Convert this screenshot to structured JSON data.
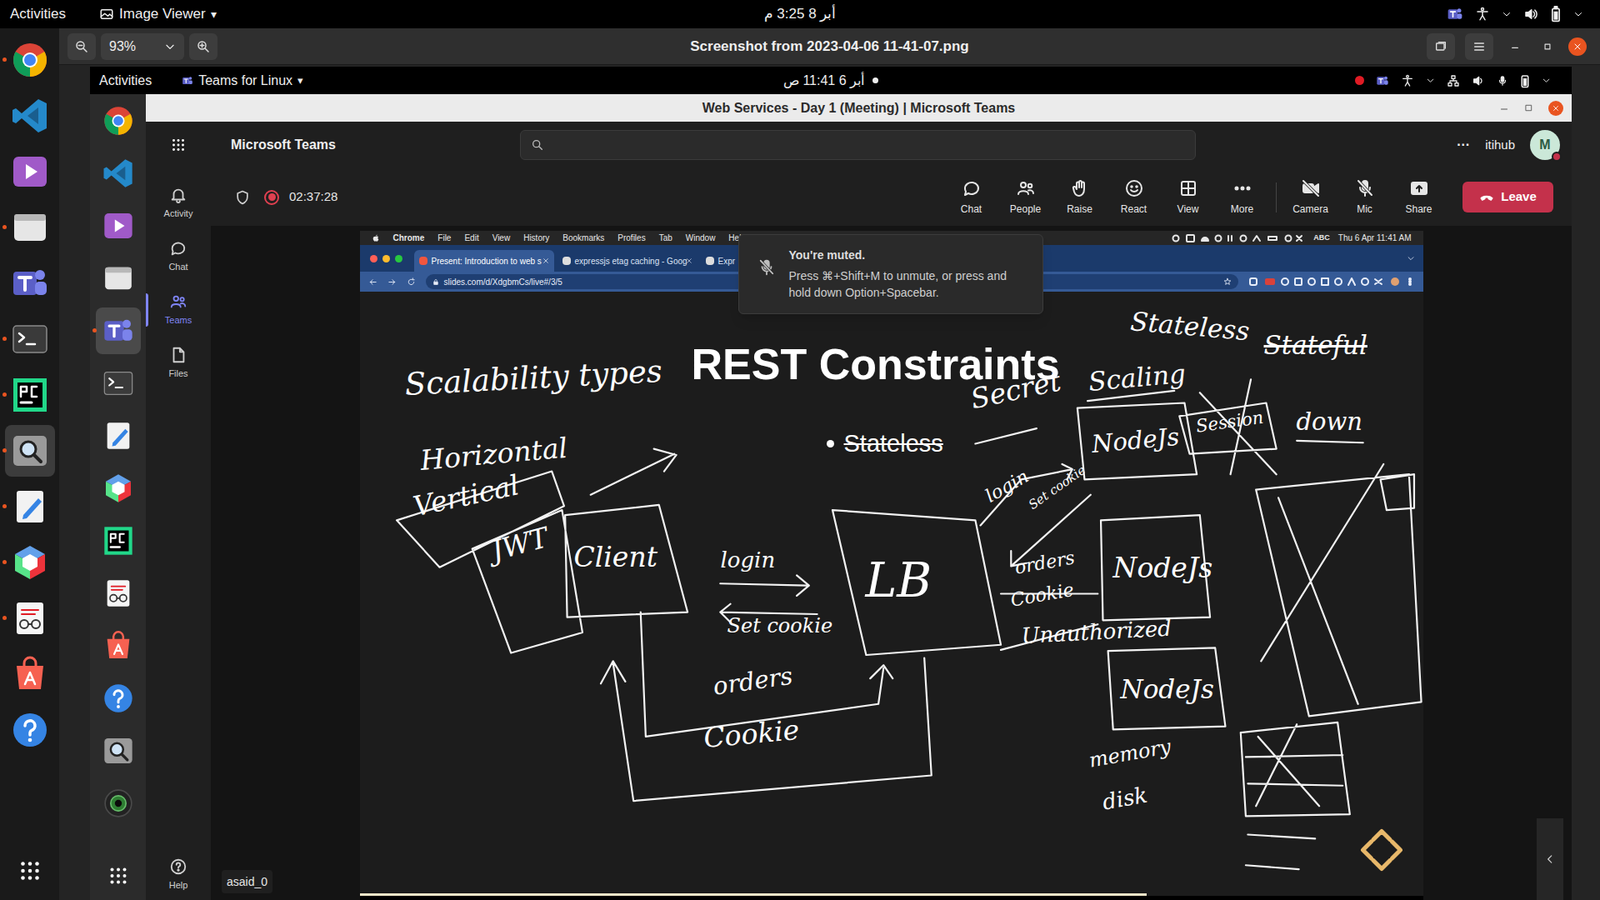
{
  "desktop": {
    "top_bar": {
      "activities": "Activities",
      "app": "Image Viewer",
      "app_menu_arrow": "▾",
      "clock": "أبر 8  3:25 م"
    },
    "dock": [
      {
        "kind": "chrome",
        "running": true,
        "selected": false
      },
      {
        "kind": "vscode",
        "running": false,
        "selected": false
      },
      {
        "kind": "videos",
        "running": false,
        "selected": false
      },
      {
        "kind": "files",
        "running": true,
        "selected": false
      },
      {
        "kind": "teams",
        "running": false,
        "selected": false
      },
      {
        "kind": "terminal",
        "running": true,
        "selected": false
      },
      {
        "kind": "pycharm",
        "running": true,
        "selected": false
      },
      {
        "kind": "magnifier",
        "running": true,
        "selected": true
      },
      {
        "kind": "editor",
        "running": true,
        "selected": false
      },
      {
        "kind": "cube",
        "running": true,
        "selected": false
      },
      {
        "kind": "docview",
        "running": true,
        "selected": false
      },
      {
        "kind": "software",
        "running": false,
        "selected": false
      },
      {
        "kind": "help",
        "running": false,
        "selected": false
      }
    ]
  },
  "viewer": {
    "zoom": "93%",
    "title": "Screenshot from 2023-04-06 11-41-07.png"
  },
  "inner_desktop": {
    "top_bar": {
      "activities": "Activities",
      "app": "Teams for Linux",
      "app_menu_arrow": "▾",
      "clock": "أبر 6  11:41 ص",
      "notification_dot": true,
      "recording_dot": true
    },
    "dock": [
      {
        "kind": "chrome",
        "running": false,
        "selected": false
      },
      {
        "kind": "vscode",
        "running": false,
        "selected": false
      },
      {
        "kind": "videos",
        "running": false,
        "selected": false
      },
      {
        "kind": "files",
        "running": false,
        "selected": false
      },
      {
        "kind": "teams",
        "running": true,
        "selected": true
      },
      {
        "kind": "terminal",
        "running": false,
        "selected": false
      },
      {
        "kind": "editor",
        "running": false,
        "selected": false
      },
      {
        "kind": "cube",
        "running": false,
        "selected": false
      },
      {
        "kind": "pycharm",
        "running": false,
        "selected": false
      },
      {
        "kind": "docview",
        "running": false,
        "selected": false
      },
      {
        "kind": "software",
        "running": false,
        "selected": false
      },
      {
        "kind": "help",
        "running": false,
        "selected": false
      },
      {
        "kind": "magnifier",
        "running": false,
        "selected": false
      },
      {
        "kind": "webcam",
        "running": false,
        "selected": false
      }
    ]
  },
  "teams": {
    "window_title": "Web Services - Day 1 (Meeting) | Microsoft Teams",
    "app_name": "Microsoft Teams",
    "search_placeholder": "Search",
    "more": "···",
    "org": "itihub",
    "avatar": "M",
    "avatar_busy": true,
    "rail": [
      {
        "label": "Activity",
        "kind": "bell",
        "selected": false
      },
      {
        "label": "Chat",
        "kind": "chat",
        "selected": false
      },
      {
        "label": "Teams",
        "kind": "teams",
        "selected": true
      },
      {
        "label": "Files",
        "kind": "file",
        "selected": false
      }
    ],
    "help": "Help",
    "meeting": {
      "recording": true,
      "timer": "02:37:28",
      "buttons": [
        {
          "label": "Chat",
          "kind": "chat",
          "off": false
        },
        {
          "label": "People",
          "kind": "people",
          "off": false
        },
        {
          "label": "Raise",
          "kind": "hand",
          "off": false
        },
        {
          "label": "React",
          "kind": "smile",
          "off": false
        },
        {
          "label": "View",
          "kind": "grid",
          "off": false
        },
        {
          "label": "More",
          "kind": "dots",
          "off": false
        },
        {
          "label": "Camera",
          "kind": "camera",
          "off": true
        },
        {
          "label": "Mic",
          "kind": "mic",
          "off": true
        },
        {
          "label": "Share",
          "kind": "share",
          "off": false
        }
      ],
      "leave": "Leave",
      "participant": "asaid_0"
    }
  },
  "shared_screen": {
    "mac_menu": [
      "Chrome",
      "File",
      "Edit",
      "View",
      "History",
      "Bookmarks",
      "Profiles",
      "Tab",
      "Window",
      "Help"
    ],
    "mac_abc": "ABC",
    "mac_clock": "Thu 6 Apr 11:41 AM",
    "tabs": [
      {
        "label": "Present: Introduction to web s",
        "selected": true
      },
      {
        "label": "expressjs etag caching - Goog",
        "selected": false
      },
      {
        "label": "Expr",
        "selected": false
      }
    ],
    "url": "slides.com/d/XdgbmCs/live#/3/5"
  },
  "toast": {
    "title": "You're muted.",
    "body": "Press ⌘+Shift+M to unmute, or press and hold down Option+Spacebar."
  },
  "slide": {
    "title": "REST Constraints",
    "bullets": [
      {
        "text": "Stateless",
        "struck": true
      }
    ],
    "progress": 0.74,
    "annotations": [
      {
        "text": "Scalability types",
        "struck": false
      },
      {
        "text": "Horizontal",
        "struck": false
      },
      {
        "text": "Vertical",
        "struck": false
      },
      {
        "text": "JWT",
        "struck": false
      },
      {
        "text": "Client",
        "struck": false
      },
      {
        "text": "login",
        "struck": false
      },
      {
        "text": "Set cookie",
        "struck": false
      },
      {
        "text": "orders",
        "struck": false
      },
      {
        "text": "Cookie",
        "struck": false
      },
      {
        "text": "LB",
        "struck": false
      },
      {
        "text": "Secret",
        "struck": false
      },
      {
        "text": "Stateless",
        "struck": false
      },
      {
        "text": "Stateful",
        "struck": true
      },
      {
        "text": "Scaling",
        "struck": false
      },
      {
        "text": "NodeJs",
        "struck": false
      },
      {
        "text": "Session",
        "struck": false
      },
      {
        "text": "down",
        "struck": false
      },
      {
        "text": "login",
        "struck": false
      },
      {
        "text": "Set cookie",
        "struck": false
      },
      {
        "text": "orders",
        "struck": false
      },
      {
        "text": "Cookie",
        "struck": false
      },
      {
        "text": "NodeJs",
        "struck": false
      },
      {
        "text": "Unauthorized",
        "struck": false
      },
      {
        "text": "NodeJs",
        "struck": false
      },
      {
        "text": "memory",
        "struck": false
      },
      {
        "text": "disk",
        "struck": false
      }
    ]
  }
}
